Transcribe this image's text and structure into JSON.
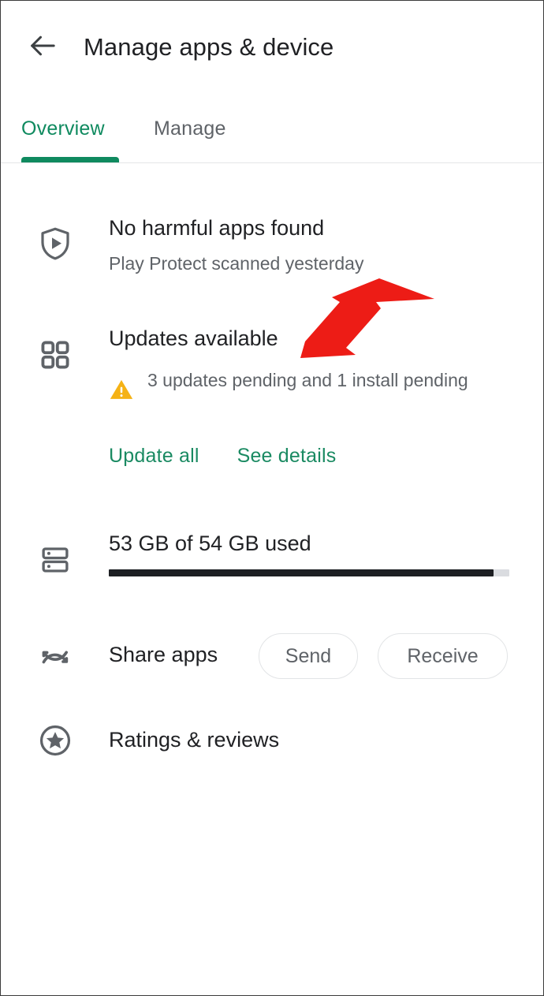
{
  "appbar": {
    "back_icon": "arrow-left-icon",
    "title": "Manage apps & device"
  },
  "tabs": [
    {
      "label": "Overview",
      "active": true
    },
    {
      "label": "Manage",
      "active": false
    }
  ],
  "colors": {
    "accent_green": "#0f8a5f",
    "link_green": "#1a8a62",
    "warning_amber": "#f5b215",
    "annotation_red": "#ed1c16",
    "text_primary": "#202124",
    "text_secondary": "#5f6368",
    "progress_fill": "#1d1f23",
    "progress_track": "#dadce0"
  },
  "rows": {
    "play_protect": {
      "icon": "shield-play-icon",
      "title": "No harmful apps found",
      "subtitle": "Play Protect scanned yesterday"
    },
    "updates": {
      "icon": "apps-grid-icon",
      "warning_icon": "warning-triangle-icon",
      "title": "Updates available",
      "subtitle": "3 updates pending and 1 install pending",
      "update_all_label": "Update all",
      "see_details_label": "See details"
    },
    "storage": {
      "icon": "storage-icon",
      "title": "53 GB of 54 GB used",
      "used_gb": 53,
      "total_gb": 54,
      "percent_used": 96
    },
    "share_apps": {
      "icon": "nearby-share-icon",
      "title": "Share apps",
      "send_label": "Send",
      "receive_label": "Receive"
    },
    "ratings": {
      "icon": "star-circle-icon",
      "title": "Ratings & reviews"
    }
  },
  "annotation": {
    "type": "red-arrow",
    "points_to": "Updates available"
  }
}
